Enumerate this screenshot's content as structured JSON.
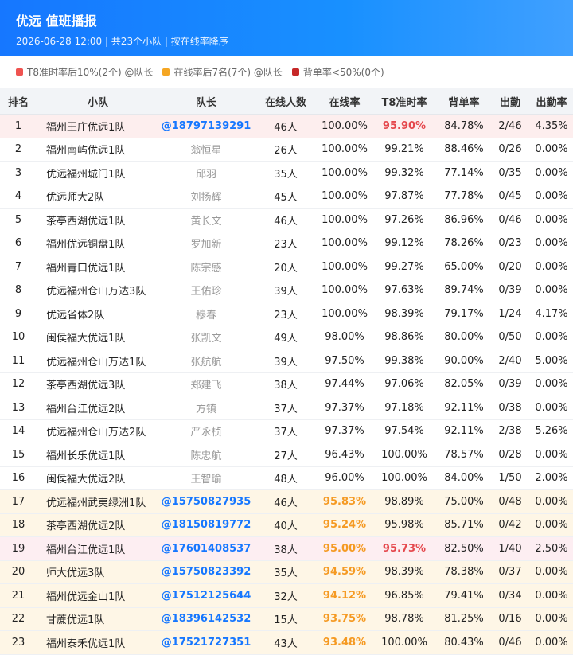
{
  "header": {
    "title": "优远 值班播报",
    "subtitle": "2026-06-28 12:00 | 共23个小队 | 按在线率降序"
  },
  "legend": [
    {
      "label": "T8准时率后10%(2个) @队长",
      "color": "#ef5350"
    },
    {
      "label": "在线率后7名(7个) @队长",
      "color": "#f5a623"
    },
    {
      "label": "背单率<50%(0个)",
      "color": "#c62828"
    }
  ],
  "columns": [
    "排名",
    "小队",
    "队长",
    "在线人数",
    "在线率",
    "T8准时率",
    "背单率",
    "出勤",
    "出勤率"
  ],
  "rows": [
    {
      "rank": "1",
      "team": "福州王庄优远1队",
      "leader": "@18797139291",
      "count": "46人",
      "online": "100.00%",
      "t8": "95.90%",
      "back": "84.78%",
      "att": "2/46",
      "attr": "4.35%",
      "hl": "red",
      "link": true,
      "onlineFlag": "",
      "t8Flag": "bad"
    },
    {
      "rank": "2",
      "team": "福州南屿优远1队",
      "leader": "翁恒星",
      "count": "26人",
      "online": "100.00%",
      "t8": "99.21%",
      "back": "88.46%",
      "att": "0/26",
      "attr": "0.00%",
      "hl": "",
      "link": false,
      "onlineFlag": "",
      "t8Flag": ""
    },
    {
      "rank": "3",
      "team": "优远福州城门1队",
      "leader": "邱羽",
      "count": "35人",
      "online": "100.00%",
      "t8": "99.32%",
      "back": "77.14%",
      "att": "0/35",
      "attr": "0.00%",
      "hl": "",
      "link": false,
      "onlineFlag": "",
      "t8Flag": ""
    },
    {
      "rank": "4",
      "team": "优远师大2队",
      "leader": "刘扬辉",
      "count": "45人",
      "online": "100.00%",
      "t8": "97.87%",
      "back": "77.78%",
      "att": "0/45",
      "attr": "0.00%",
      "hl": "",
      "link": false,
      "onlineFlag": "",
      "t8Flag": ""
    },
    {
      "rank": "5",
      "team": "茶亭西湖优远1队",
      "leader": "黄长文",
      "count": "46人",
      "online": "100.00%",
      "t8": "97.26%",
      "back": "86.96%",
      "att": "0/46",
      "attr": "0.00%",
      "hl": "",
      "link": false,
      "onlineFlag": "",
      "t8Flag": ""
    },
    {
      "rank": "6",
      "team": "福州优远铜盘1队",
      "leader": "罗加新",
      "count": "23人",
      "online": "100.00%",
      "t8": "99.12%",
      "back": "78.26%",
      "att": "0/23",
      "attr": "0.00%",
      "hl": "",
      "link": false,
      "onlineFlag": "",
      "t8Flag": ""
    },
    {
      "rank": "7",
      "team": "福州青口优远1队",
      "leader": "陈宗感",
      "count": "20人",
      "online": "100.00%",
      "t8": "99.27%",
      "back": "65.00%",
      "att": "0/20",
      "attr": "0.00%",
      "hl": "",
      "link": false,
      "onlineFlag": "",
      "t8Flag": ""
    },
    {
      "rank": "8",
      "team": "优远福州仓山万达3队",
      "leader": "王佑珍",
      "count": "39人",
      "online": "100.00%",
      "t8": "97.63%",
      "back": "89.74%",
      "att": "0/39",
      "attr": "0.00%",
      "hl": "",
      "link": false,
      "onlineFlag": "",
      "t8Flag": ""
    },
    {
      "rank": "9",
      "team": "优远省体2队",
      "leader": "穆春",
      "count": "23人",
      "online": "100.00%",
      "t8": "98.39%",
      "back": "79.17%",
      "att": "1/24",
      "attr": "4.17%",
      "hl": "",
      "link": false,
      "onlineFlag": "",
      "t8Flag": ""
    },
    {
      "rank": "10",
      "team": "闽侯福大优远1队",
      "leader": "张凯文",
      "count": "49人",
      "online": "98.00%",
      "t8": "98.86%",
      "back": "80.00%",
      "att": "0/50",
      "attr": "0.00%",
      "hl": "",
      "link": false,
      "onlineFlag": "",
      "t8Flag": ""
    },
    {
      "rank": "11",
      "team": "优远福州仓山万达1队",
      "leader": "张航航",
      "count": "39人",
      "online": "97.50%",
      "t8": "99.38%",
      "back": "90.00%",
      "att": "2/40",
      "attr": "5.00%",
      "hl": "",
      "link": false,
      "onlineFlag": "",
      "t8Flag": ""
    },
    {
      "rank": "12",
      "team": "茶亭西湖优远3队",
      "leader": "郑建飞",
      "count": "38人",
      "online": "97.44%",
      "t8": "97.06%",
      "back": "82.05%",
      "att": "0/39",
      "attr": "0.00%",
      "hl": "",
      "link": false,
      "onlineFlag": "",
      "t8Flag": ""
    },
    {
      "rank": "13",
      "team": "福州台江优远2队",
      "leader": "方镇",
      "count": "37人",
      "online": "97.37%",
      "t8": "97.18%",
      "back": "92.11%",
      "att": "0/38",
      "attr": "0.00%",
      "hl": "",
      "link": false,
      "onlineFlag": "",
      "t8Flag": ""
    },
    {
      "rank": "14",
      "team": "优远福州仓山万达2队",
      "leader": "严永桢",
      "count": "37人",
      "online": "97.37%",
      "t8": "97.54%",
      "back": "92.11%",
      "att": "2/38",
      "attr": "5.26%",
      "hl": "",
      "link": false,
      "onlineFlag": "",
      "t8Flag": ""
    },
    {
      "rank": "15",
      "team": "福州长乐优远1队",
      "leader": "陈忠航",
      "count": "27人",
      "online": "96.43%",
      "t8": "100.00%",
      "back": "78.57%",
      "att": "0/28",
      "attr": "0.00%",
      "hl": "",
      "link": false,
      "onlineFlag": "",
      "t8Flag": ""
    },
    {
      "rank": "16",
      "team": "闽侯福大优远2队",
      "leader": "王智瑜",
      "count": "48人",
      "online": "96.00%",
      "t8": "100.00%",
      "back": "84.00%",
      "att": "1/50",
      "attr": "2.00%",
      "hl": "",
      "link": false,
      "onlineFlag": "",
      "t8Flag": ""
    },
    {
      "rank": "17",
      "team": "优远福州武夷绿洲1队",
      "leader": "@15750827935",
      "count": "46人",
      "online": "95.83%",
      "t8": "98.89%",
      "back": "75.00%",
      "att": "0/48",
      "attr": "0.00%",
      "hl": "orange",
      "link": true,
      "onlineFlag": "orange",
      "t8Flag": ""
    },
    {
      "rank": "18",
      "team": "茶亭西湖优远2队",
      "leader": "@18150819772",
      "count": "40人",
      "online": "95.24%",
      "t8": "95.98%",
      "back": "85.71%",
      "att": "0/42",
      "attr": "0.00%",
      "hl": "orange",
      "link": true,
      "onlineFlag": "orange",
      "t8Flag": ""
    },
    {
      "rank": "19",
      "team": "福州台江优远1队",
      "leader": "@17601408537",
      "count": "38人",
      "online": "95.00%",
      "t8": "95.73%",
      "back": "82.50%",
      "att": "1/40",
      "attr": "2.50%",
      "hl": "pink",
      "link": true,
      "onlineFlag": "orange",
      "t8Flag": "bad"
    },
    {
      "rank": "20",
      "team": "师大优远3队",
      "leader": "@15750823392",
      "count": "35人",
      "online": "94.59%",
      "t8": "98.39%",
      "back": "78.38%",
      "att": "0/37",
      "attr": "0.00%",
      "hl": "orange",
      "link": true,
      "onlineFlag": "orange",
      "t8Flag": ""
    },
    {
      "rank": "21",
      "team": "福州优远金山1队",
      "leader": "@17512125644",
      "count": "32人",
      "online": "94.12%",
      "t8": "96.85%",
      "back": "79.41%",
      "att": "0/34",
      "attr": "0.00%",
      "hl": "orange",
      "link": true,
      "onlineFlag": "orange",
      "t8Flag": ""
    },
    {
      "rank": "22",
      "team": "甘蔗优远1队",
      "leader": "@18396142532",
      "count": "15人",
      "online": "93.75%",
      "t8": "98.78%",
      "back": "81.25%",
      "att": "0/16",
      "attr": "0.00%",
      "hl": "orange",
      "link": true,
      "onlineFlag": "orange",
      "t8Flag": ""
    },
    {
      "rank": "23",
      "team": "福州泰禾优远1队",
      "leader": "@17521727351",
      "count": "43人",
      "online": "93.48%",
      "t8": "100.00%",
      "back": "80.43%",
      "att": "0/46",
      "attr": "0.00%",
      "hl": "orange",
      "link": true,
      "onlineFlag": "orange",
      "t8Flag": ""
    }
  ]
}
